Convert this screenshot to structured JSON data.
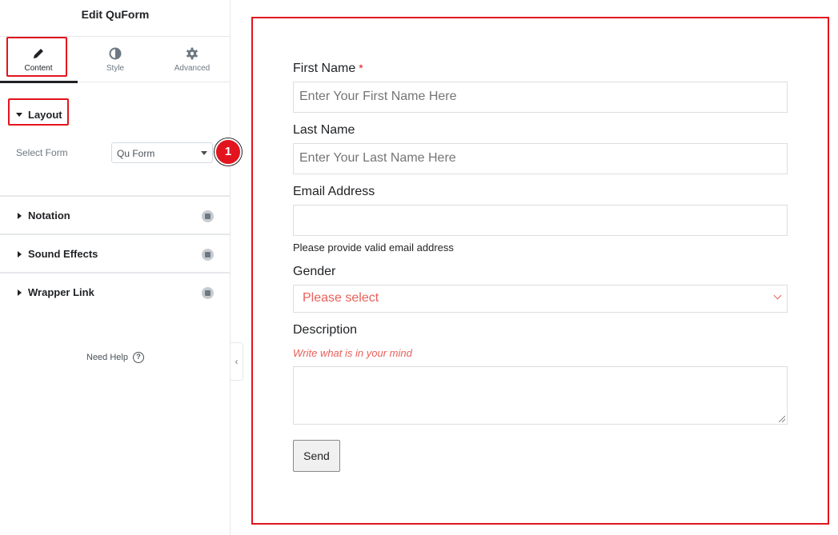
{
  "panel": {
    "title": "Edit QuForm",
    "tabs": [
      {
        "label": "Content",
        "icon": "pencil-icon",
        "active": true
      },
      {
        "label": "Style",
        "icon": "contrast-icon",
        "active": false
      },
      {
        "label": "Advanced",
        "icon": "gear-icon",
        "active": false
      }
    ],
    "layout_section": {
      "label": "Layout",
      "select_form_label": "Select Form",
      "select_form_value": "Qu Form",
      "marker": "1"
    },
    "sections": [
      {
        "label": "Notation",
        "icon": "pro-badge-icon"
      },
      {
        "label": "Sound Effects",
        "icon": "pro-badge-icon"
      },
      {
        "label": "Wrapper Link",
        "icon": "pro-badge-icon"
      }
    ],
    "need_help": "Need Help",
    "help_icon": "?",
    "collapse_icon": "‹"
  },
  "form": {
    "first_name_label": "First Name",
    "required_mark": "*",
    "first_name_placeholder": "Enter Your First Name Here",
    "last_name_label": "Last Name",
    "last_name_placeholder": "Enter Your Last Name Here",
    "email_label": "Email Address",
    "email_value": "",
    "email_hint": "Please provide valid email address",
    "gender_label": "Gender",
    "gender_selected": "Please select",
    "description_label": "Description",
    "description_hint": "Write what is in your mind",
    "send_label": "Send"
  },
  "colors": {
    "highlight_red": "#e2141e",
    "placeholder_red": "#e8605a",
    "panel_text": "#1f2124"
  }
}
